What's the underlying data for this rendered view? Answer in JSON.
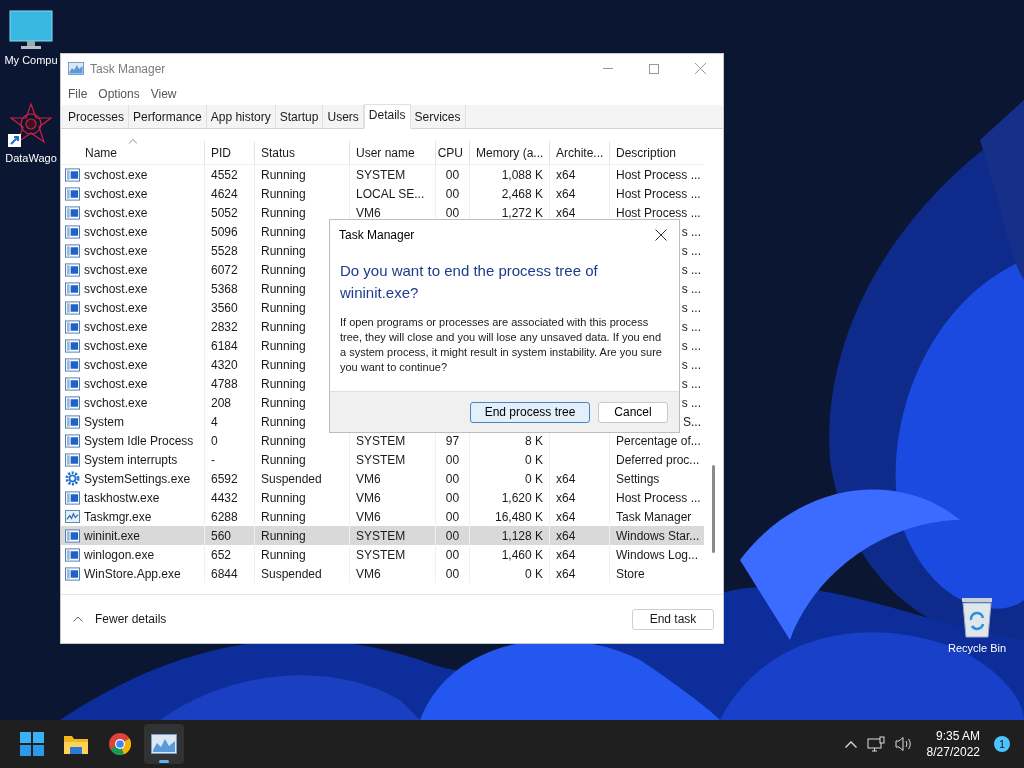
{
  "desktop": {
    "icons": [
      {
        "kind": "computer",
        "label": "My Compu"
      },
      {
        "kind": "shortcut",
        "label": "DataWago"
      },
      {
        "kind": "recycle",
        "label": "Recycle Bin"
      }
    ]
  },
  "window": {
    "title": "Task Manager",
    "menu": [
      "File",
      "Options",
      "View"
    ],
    "tabs": [
      {
        "label": "Processes",
        "selected": false
      },
      {
        "label": "Performance",
        "selected": false
      },
      {
        "label": "App history",
        "selected": false
      },
      {
        "label": "Startup",
        "selected": false
      },
      {
        "label": "Users",
        "selected": false
      },
      {
        "label": "Details",
        "selected": true
      },
      {
        "label": "Services",
        "selected": false
      }
    ],
    "table": {
      "columns": [
        {
          "label": "Name",
          "sorted": true
        },
        {
          "label": "PID",
          "sorted": false
        },
        {
          "label": "Status",
          "sorted": false
        },
        {
          "label": "User name",
          "sorted": false
        },
        {
          "label": "CPU",
          "sorted": false
        },
        {
          "label": "Memory (a...",
          "sorted": false
        },
        {
          "label": "Archite...",
          "sorted": false
        },
        {
          "label": "Description",
          "sorted": false
        }
      ],
      "rows": [
        {
          "kind": "app",
          "name": "svchost.exe",
          "pid": "4552",
          "status": "Running",
          "user": "SYSTEM",
          "cpu": "00",
          "memory": "1,088 K",
          "arch": "x64",
          "description": "Host Process ...",
          "selected": false
        },
        {
          "kind": "app",
          "name": "svchost.exe",
          "pid": "4624",
          "status": "Running",
          "user": "LOCAL SE...",
          "cpu": "00",
          "memory": "2,468 K",
          "arch": "x64",
          "description": "Host Process ...",
          "selected": false
        },
        {
          "kind": "app",
          "name": "svchost.exe",
          "pid": "5052",
          "status": "Running",
          "user": "VM6",
          "cpu": "00",
          "memory": "1,272 K",
          "arch": "x64",
          "description": "Host Process ...",
          "selected": false
        },
        {
          "kind": "app",
          "name": "svchost.exe",
          "pid": "5096",
          "status": "Running",
          "description": "s ...",
          "selected": false
        },
        {
          "kind": "app",
          "name": "svchost.exe",
          "pid": "5528",
          "status": "Running",
          "description": "s ...",
          "selected": false
        },
        {
          "kind": "app",
          "name": "svchost.exe",
          "pid": "6072",
          "status": "Running",
          "description": "s ...",
          "selected": false
        },
        {
          "kind": "app",
          "name": "svchost.exe",
          "pid": "5368",
          "status": "Running",
          "description": "s ...",
          "selected": false
        },
        {
          "kind": "app",
          "name": "svchost.exe",
          "pid": "3560",
          "status": "Running",
          "description": "s ...",
          "selected": false
        },
        {
          "kind": "app",
          "name": "svchost.exe",
          "pid": "2832",
          "status": "Running",
          "description": "s ...",
          "selected": false
        },
        {
          "kind": "app",
          "name": "svchost.exe",
          "pid": "6184",
          "status": "Running",
          "description": "s ...",
          "selected": false
        },
        {
          "kind": "app",
          "name": "svchost.exe",
          "pid": "4320",
          "status": "Running",
          "description": "s ...",
          "selected": false
        },
        {
          "kind": "app",
          "name": "svchost.exe",
          "pid": "4788",
          "status": "Running",
          "description": "s ...",
          "selected": false
        },
        {
          "kind": "app",
          "name": "svchost.exe",
          "pid": "208",
          "status": "Running",
          "description": "s ...",
          "selected": false
        },
        {
          "kind": "app",
          "name": "System",
          "pid": "4",
          "status": "Running",
          "description": "S...",
          "selected": false
        },
        {
          "kind": "app",
          "name": "System Idle Process",
          "pid": "0",
          "status": "Running",
          "user": "SYSTEM",
          "cpu": "97",
          "memory": "8 K",
          "description": "Percentage of...",
          "selected": false
        },
        {
          "kind": "app",
          "name": "System interrupts",
          "pid": "-",
          "status": "Running",
          "user": "SYSTEM",
          "cpu": "00",
          "memory": "0 K",
          "description": "Deferred proc...",
          "selected": false
        },
        {
          "kind": "settings",
          "name": "SystemSettings.exe",
          "pid": "6592",
          "status": "Suspended",
          "user": "VM6",
          "cpu": "00",
          "memory": "0 K",
          "arch": "x64",
          "description": "Settings",
          "selected": false
        },
        {
          "kind": "app",
          "name": "taskhostw.exe",
          "pid": "4432",
          "status": "Running",
          "user": "VM6",
          "cpu": "00",
          "memory": "1,620 K",
          "arch": "x64",
          "description": "Host Process ...",
          "selected": false
        },
        {
          "kind": "taskmgr",
          "name": "Taskmgr.exe",
          "pid": "6288",
          "status": "Running",
          "user": "VM6",
          "cpu": "00",
          "memory": "16,480 K",
          "arch": "x64",
          "description": "Task Manager",
          "selected": false
        },
        {
          "kind": "app",
          "name": "wininit.exe",
          "pid": "560",
          "status": "Running",
          "user": "SYSTEM",
          "cpu": "00",
          "memory": "1,128 K",
          "arch": "x64",
          "description": "Windows Star...",
          "selected": true
        },
        {
          "kind": "app",
          "name": "winlogon.exe",
          "pid": "652",
          "status": "Running",
          "user": "SYSTEM",
          "cpu": "00",
          "memory": "1,460 K",
          "arch": "x64",
          "description": "Windows Log...",
          "selected": false
        },
        {
          "kind": "app",
          "name": "WinStore.App.exe",
          "pid": "6844",
          "status": "Suspended",
          "user": "VM6",
          "cpu": "00",
          "memory": "0 K",
          "arch": "x64",
          "description": "Store",
          "selected": false
        }
      ]
    },
    "footer": {
      "toggle": "Fewer details",
      "button": "End task"
    }
  },
  "dialog": {
    "title": "Task Manager",
    "heading": "Do you want to end the process tree of wininit.exe?",
    "message": "If open programs or processes are associated with this process tree, they will close and you will lose any unsaved data. If you end a system process, it might result in system instability. Are you sure you want to continue?",
    "buttons": [
      {
        "label": "End process tree",
        "kind": "primary"
      },
      {
        "label": "Cancel",
        "kind": "secondary"
      }
    ]
  },
  "taskbar": {
    "apps": [
      {
        "kind": "start",
        "active": false
      },
      {
        "kind": "explorer",
        "active": false
      },
      {
        "kind": "chrome",
        "active": false
      },
      {
        "kind": "taskmgr",
        "active": true
      }
    ],
    "time": "9:35 AM",
    "date": "8/27/2022",
    "notifications": "1"
  }
}
